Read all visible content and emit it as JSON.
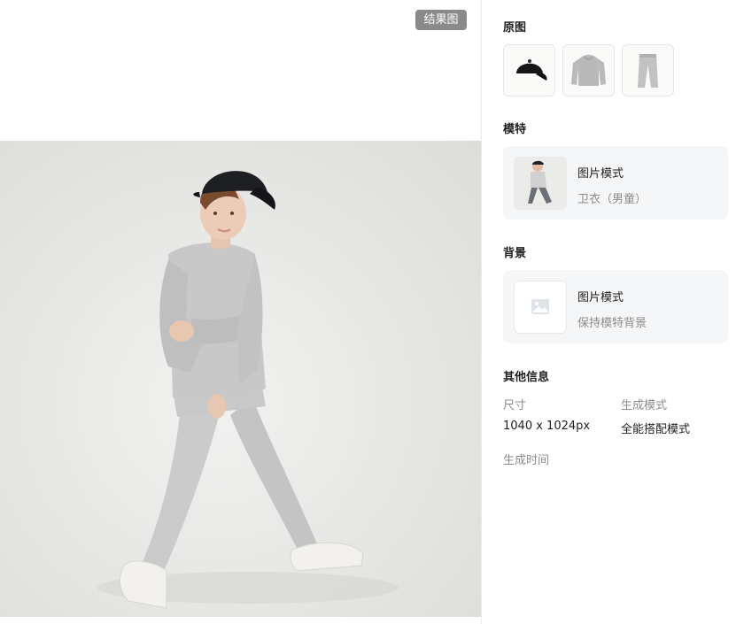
{
  "result": {
    "badge_label": "结果图"
  },
  "sidebar": {
    "original": {
      "title": "原图",
      "items": [
        {
          "name": "cap-thumbnail"
        },
        {
          "name": "sweatshirt-thumbnail"
        },
        {
          "name": "pants-thumbnail"
        }
      ]
    },
    "model": {
      "title": "模特",
      "mode": "图片模式",
      "description": "卫衣（男童）"
    },
    "background": {
      "title": "背景",
      "mode": "图片模式",
      "description": "保持模特背景"
    },
    "other_info": {
      "title": "其他信息",
      "size_label": "尺寸",
      "size_value": "1040 x 1024px",
      "mode_label": "生成模式",
      "mode_value": "全能搭配模式",
      "time_label": "生成时间"
    }
  },
  "colors": {
    "badge_bg": "#8a8a8a",
    "card_bg": "#f5f6f8",
    "muted_text": "#8c8c8c"
  }
}
